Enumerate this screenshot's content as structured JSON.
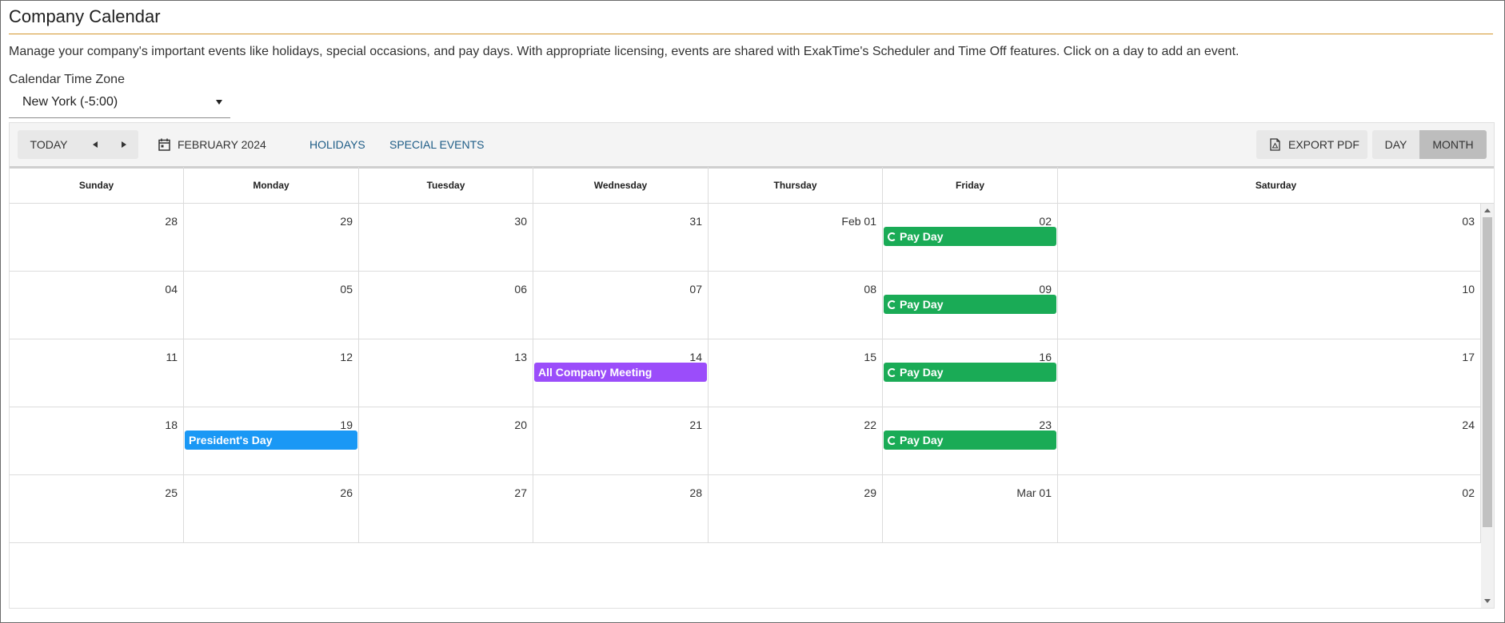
{
  "page": {
    "title": "Company Calendar",
    "description": "Manage your company's important events like holidays, special occasions, and pay days. With appropriate licensing, events are shared with ExakTime's Scheduler and Time Off features. Click on a day to add an event.",
    "accent_color": "#d4962e"
  },
  "timezone": {
    "label": "Calendar Time Zone",
    "selected": "New York (-5:00)"
  },
  "toolbar": {
    "today": "TODAY",
    "prev_icon": "caret-left-icon",
    "next_icon": "caret-right-icon",
    "date_icon": "calendar-icon",
    "date_label": "FEBRUARY 2024",
    "holidays": "HOLIDAYS",
    "special_events": "SPECIAL EVENTS",
    "export_icon": "pdf-icon",
    "export_pdf": "EXPORT PDF",
    "day": "DAY",
    "month": "MONTH",
    "active_view": "MONTH"
  },
  "days_of_week": [
    "Sunday",
    "Monday",
    "Tuesday",
    "Wednesday",
    "Thursday",
    "Friday",
    "Saturday"
  ],
  "weeks": [
    [
      "28",
      "29",
      "30",
      "31",
      "Feb 01",
      "02",
      "03"
    ],
    [
      "04",
      "05",
      "06",
      "07",
      "08",
      "09",
      "10"
    ],
    [
      "11",
      "12",
      "13",
      "14",
      "15",
      "16",
      "17"
    ],
    [
      "18",
      "19",
      "20",
      "21",
      "22",
      "23",
      "24"
    ],
    [
      "25",
      "26",
      "27",
      "28",
      "29",
      "Mar 01",
      "02"
    ]
  ],
  "events": [
    {
      "week": 0,
      "day": 5,
      "title": "Pay Day",
      "color": "#1aab56",
      "recurring": true
    },
    {
      "week": 1,
      "day": 5,
      "title": "Pay Day",
      "color": "#1aab56",
      "recurring": true
    },
    {
      "week": 2,
      "day": 3,
      "title": "All Company Meeting",
      "color": "#9b4dfa",
      "recurring": false
    },
    {
      "week": 2,
      "day": 5,
      "title": "Pay Day",
      "color": "#1aab56",
      "recurring": true
    },
    {
      "week": 3,
      "day": 1,
      "title": "President's Day",
      "color": "#1a98f5",
      "recurring": false
    },
    {
      "week": 3,
      "day": 5,
      "title": "Pay Day",
      "color": "#1aab56",
      "recurring": true
    }
  ]
}
